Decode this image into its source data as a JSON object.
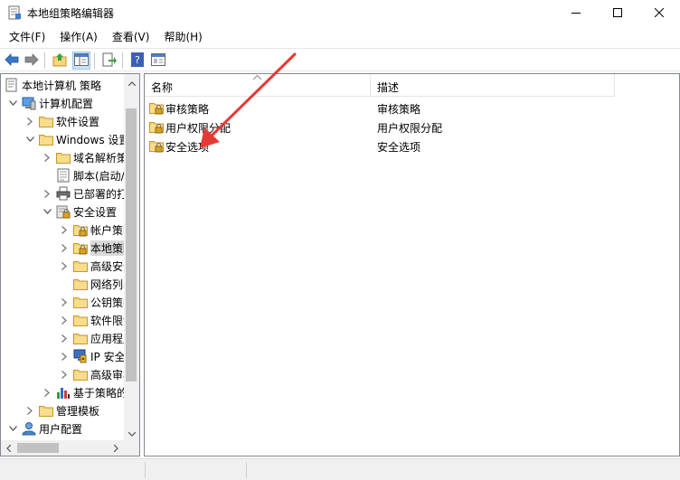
{
  "window": {
    "title": "本地组策略编辑器",
    "icon": "policy-editor-icon",
    "controls": [
      "minimize-icon",
      "maximize-icon",
      "close-icon"
    ]
  },
  "menu": [
    "文件(F)",
    "操作(A)",
    "查看(V)",
    "帮助(H)"
  ],
  "toolbar": {
    "buttons": [
      "back-arrow-icon",
      "forward-arrow-icon",
      "up-folder-icon",
      "show-hide-tree-icon",
      "export-list-icon",
      "help-icon",
      "properties-icon"
    ]
  },
  "tree": {
    "items": [
      {
        "label": "本地计算机 策略",
        "icon": "computer-policy-icon",
        "expander": "none",
        "selected": false
      },
      {
        "label": "计算机配置",
        "icon": "computer-icon",
        "expander": "expanded",
        "selected": false
      },
      {
        "label": "软件设置",
        "icon": "folder-icon",
        "expander": "collapsed",
        "selected": false
      },
      {
        "label": "Windows 设置",
        "icon": "folder-icon",
        "expander": "expanded",
        "selected": false
      },
      {
        "label": "域名解析策略",
        "icon": "folder-icon",
        "expander": "collapsed",
        "selected": false
      },
      {
        "label": "脚本(启动/关机)",
        "icon": "script-icon",
        "expander": "none",
        "selected": false
      },
      {
        "label": "已部署的打印机",
        "icon": "printer-icon",
        "expander": "collapsed",
        "selected": false
      },
      {
        "label": "安全设置",
        "icon": "security-settings-icon",
        "expander": "expanded",
        "selected": false
      },
      {
        "label": "帐户策略",
        "icon": "locked-folder-icon",
        "expander": "collapsed",
        "selected": false
      },
      {
        "label": "本地策略",
        "icon": "locked-folder-icon",
        "expander": "collapsed",
        "selected": true
      },
      {
        "label": "高级安全 Windows Defender 防火墙",
        "icon": "folder-icon",
        "expander": "collapsed",
        "selected": false
      },
      {
        "label": "网络列表管理器策略",
        "icon": "folder-icon",
        "expander": "none",
        "selected": false
      },
      {
        "label": "公钥策略",
        "icon": "folder-icon",
        "expander": "collapsed",
        "selected": false
      },
      {
        "label": "软件限制策略",
        "icon": "folder-icon",
        "expander": "collapsed",
        "selected": false
      },
      {
        "label": "应用程序控制策略",
        "icon": "folder-icon",
        "expander": "collapsed",
        "selected": false
      },
      {
        "label": "IP 安全策略，在 本地计算机",
        "icon": "ip-security-icon",
        "expander": "collapsed",
        "selected": false
      },
      {
        "label": "高级审核策略配置",
        "icon": "folder-icon",
        "expander": "collapsed",
        "selected": false
      },
      {
        "label": "基于策略的 QoS",
        "icon": "bar-chart-icon",
        "expander": "collapsed",
        "selected": false
      },
      {
        "label": "管理模板",
        "icon": "folder-icon",
        "expander": "collapsed",
        "selected": false
      },
      {
        "label": "用户配置",
        "icon": "user-icon",
        "expander": "expanded",
        "selected": false
      }
    ]
  },
  "list": {
    "columns": [
      "名称",
      "描述"
    ],
    "rows": [
      {
        "name": "审核策略",
        "desc": "审核策略",
        "icon": "locked-folder-icon"
      },
      {
        "name": "用户权限分配",
        "desc": "用户权限分配",
        "icon": "locked-folder-icon"
      },
      {
        "name": "安全选项",
        "desc": "安全选项",
        "icon": "locked-folder-icon"
      }
    ]
  },
  "annotation": {
    "color": "#e53935",
    "icon": "red-arrow-annotation"
  },
  "colors": {
    "folder": "#f4d47c",
    "folder_dark": "#d9a636",
    "selection": "#d9d9d9",
    "accent": "#1e6fd9"
  }
}
